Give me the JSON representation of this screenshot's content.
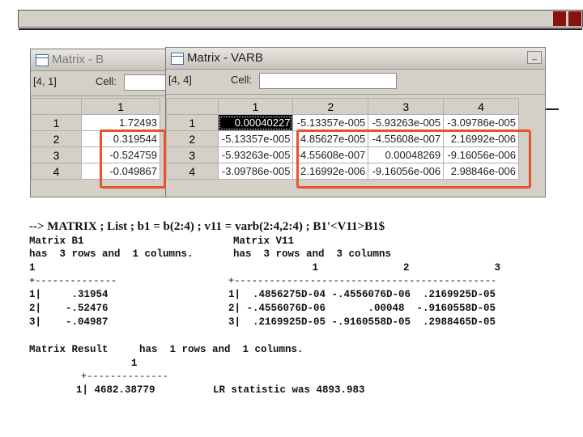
{
  "window_b": {
    "title": "Matrix - B",
    "cell_ref": "[4, 1]",
    "cell_label": "Cell:",
    "col_header": "1",
    "row_headers": [
      "1",
      "2",
      "3",
      "4"
    ],
    "values": [
      "1.72493",
      "0.319544",
      "-0.524759",
      "-0.049867"
    ]
  },
  "window_varb": {
    "title": "Matrix - VARB",
    "cell_ref": "[4, 4]",
    "cell_label": "Cell:",
    "minimize": "_",
    "col_headers": [
      "1",
      "2",
      "3",
      "4"
    ],
    "row_headers": [
      "1",
      "2",
      "3",
      "4"
    ],
    "rows": [
      [
        "0.00040227",
        "-5.13357e-005",
        "-5.93263e-005",
        "-3.09786e-005"
      ],
      [
        "-5.13357e-005",
        "4.85627e-005",
        "-4.55608e-007",
        "2.16992e-006"
      ],
      [
        "-5.93263e-005",
        "-4.55608e-007",
        "0.00048269",
        "-9.16056e-006"
      ],
      [
        "-3.09786e-005",
        "2.16992e-006",
        "-9.16056e-006",
        "2.98846e-006"
      ]
    ]
  },
  "command": "--> MATRIX ; List ; b1 = b(2:4) ; v11 = varb(2:4,2:4) ; B1'<V11>B1$",
  "output": {
    "b1_title": "Matrix B1",
    "b1_dims": "has  3 rows and  1 columns.",
    "b1_col": "1",
    "b1_sep": "+--------------",
    "b1_rows": [
      "1|     .31954",
      "2|    -.52476",
      "3|    -.04987"
    ],
    "v11_title": "Matrix V11",
    "v11_dims": "has  3 rows and  3 columns",
    "v11_cols": "             1              2              3",
    "v11_sep": "+---------------------------------------------",
    "v11_rows": [
      "1|  .4856275D-04 -.4556076D-06  .2169925D-05",
      "2| -.4556076D-06       .00048  -.9160558D-05",
      "3|  .2169925D-05 -.9160558D-05  .2988465D-05"
    ],
    "result_title": "Matrix Result",
    "result_dims": "has  1 rows and  1 columns.",
    "result_col": "1",
    "result_sep": "+--------------",
    "result_row": "1| 4682.38779",
    "lr_statistic": "LR statistic was 4893.983"
  }
}
